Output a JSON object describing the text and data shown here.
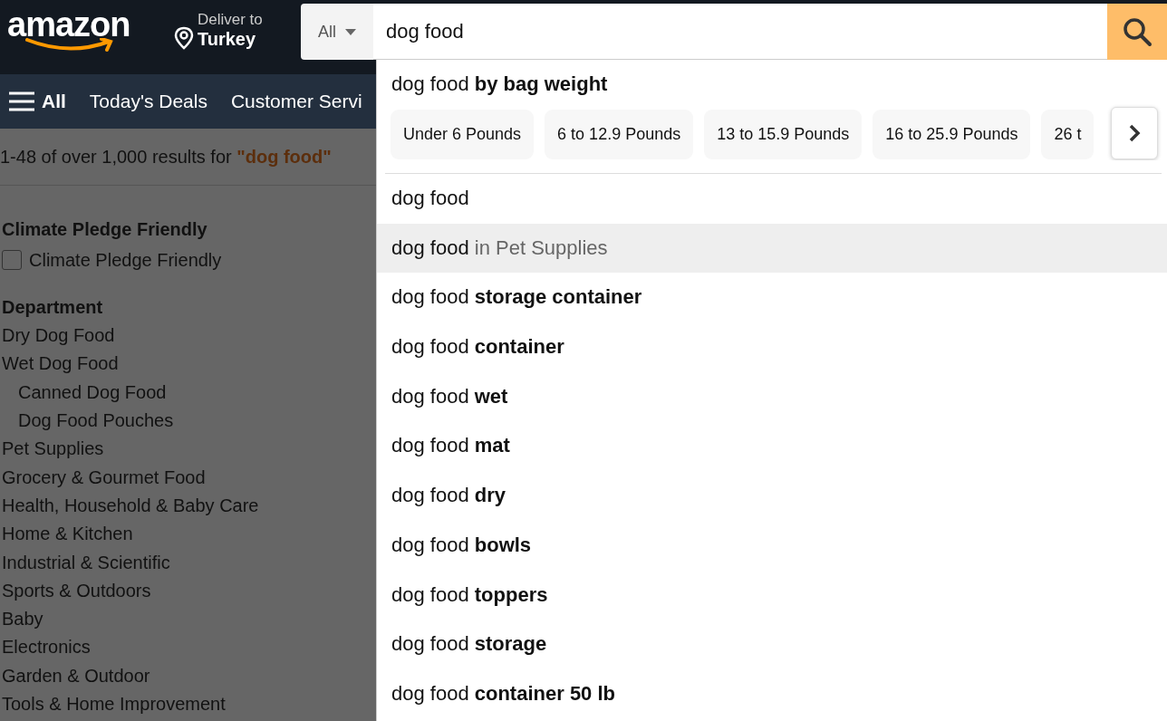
{
  "header": {
    "logo": "amazon",
    "deliver_label": "Deliver to",
    "deliver_location": "Turkey",
    "search": {
      "category": "All",
      "value": "dog food"
    }
  },
  "nav": {
    "menu_label": "All",
    "links": [
      "Today's Deals",
      "Customer Servi"
    ]
  },
  "results": {
    "summary": "1-48 of over 1,000 results for ",
    "query": "\"dog food\""
  },
  "sidebar": {
    "sections": [
      {
        "title": "Climate Pledge Friendly",
        "kind": "checkboxes",
        "items": [
          {
            "label": "Climate Pledge Friendly",
            "checked": false
          }
        ]
      },
      {
        "title": "Department",
        "kind": "links",
        "items": [
          {
            "label": "Dry Dog Food"
          },
          {
            "label": "Wet Dog Food",
            "children": [
              {
                "label": "Canned Dog Food"
              },
              {
                "label": "Dog Food Pouches"
              }
            ]
          },
          {
            "label": "Pet Supplies"
          },
          {
            "label": "Grocery & Gourmet Food"
          },
          {
            "label": "Health, Household & Baby Care"
          },
          {
            "label": "Home & Kitchen"
          },
          {
            "label": "Industrial & Scientific"
          },
          {
            "label": "Sports & Outdoors"
          },
          {
            "label": "Baby"
          },
          {
            "label": "Electronics"
          },
          {
            "label": "Garden & Outdoor"
          },
          {
            "label": "Tools & Home Improvement"
          }
        ]
      }
    ]
  },
  "suggestions": {
    "heading": "dog food **by bag weight**",
    "chips": [
      "Under 6 Pounds",
      "6 to 12.9 Pounds",
      "13 to 15.9 Pounds",
      "16 to 25.9 Pounds",
      "26 t"
    ],
    "items": [
      {
        "kind": "plain",
        "text": "dog food",
        "selected": false
      },
      {
        "kind": "scoped",
        "text": "dog food",
        "scope": "in Pet Supplies",
        "selected": true
      },
      {
        "kind": "plain",
        "text": "dog food **storage container**",
        "selected": false
      },
      {
        "kind": "plain",
        "text": "dog food **container**",
        "selected": false
      },
      {
        "kind": "plain",
        "text": "dog food **wet**",
        "selected": false
      },
      {
        "kind": "plain",
        "text": "dog food **mat**",
        "selected": false
      },
      {
        "kind": "plain",
        "text": "dog food **dry**",
        "selected": false
      },
      {
        "kind": "plain",
        "text": "dog food **bowls**",
        "selected": false
      },
      {
        "kind": "plain",
        "text": "dog food **toppers**",
        "selected": false
      },
      {
        "kind": "plain",
        "text": "dog food **storage**",
        "selected": false
      },
      {
        "kind": "plain",
        "text": "dog food **container 50 lb**",
        "selected": false
      }
    ]
  }
}
